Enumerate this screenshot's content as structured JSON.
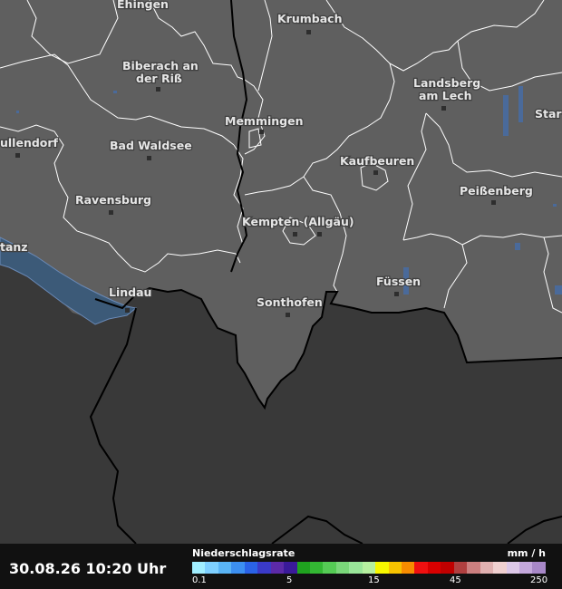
{
  "map": {
    "cities": [
      {
        "name": "Ehingen"
      },
      {
        "name": "Krumbach"
      },
      {
        "name": "Biberach an"
      },
      {
        "name": "der Riß"
      },
      {
        "name": "Landsberg"
      },
      {
        "name": "am Lech"
      },
      {
        "name": "Star"
      },
      {
        "name": "Memmingen"
      },
      {
        "name": "ullendorf"
      },
      {
        "name": "Bad Waldsee"
      },
      {
        "name": "Kaufbeuren"
      },
      {
        "name": "Peißenberg"
      },
      {
        "name": "Ravensburg"
      },
      {
        "name": "Kempten (Allgäu)"
      },
      {
        "name": "tanz"
      },
      {
        "name": "Lindau"
      },
      {
        "name": "Füssen"
      },
      {
        "name": "Sonthofen"
      }
    ]
  },
  "footer": {
    "timestamp": "30.08.26 10:20 Uhr",
    "legend_title": "Niederschlagsrate",
    "legend_unit": "mm / h",
    "legend_ticks": [
      "0.1",
      "5",
      "15",
      "45",
      "250"
    ],
    "legend_colors": [
      "#a0eeff",
      "#7ed0ff",
      "#5ab4f5",
      "#3c8ff0",
      "#2a62e6",
      "#3a3ac8",
      "#5c2aa8",
      "#3a1a9a",
      "#1fa21f",
      "#33b833",
      "#55cc55",
      "#7ad87a",
      "#99e699",
      "#b6f0a0",
      "#f7f700",
      "#f7c300",
      "#f78c00",
      "#f01010",
      "#d80000",
      "#c00000",
      "#b04040",
      "#cc8080",
      "#e0b0b0",
      "#f0d0d0",
      "#ddc8e8",
      "#c4a8dc",
      "#a888c8"
    ]
  }
}
